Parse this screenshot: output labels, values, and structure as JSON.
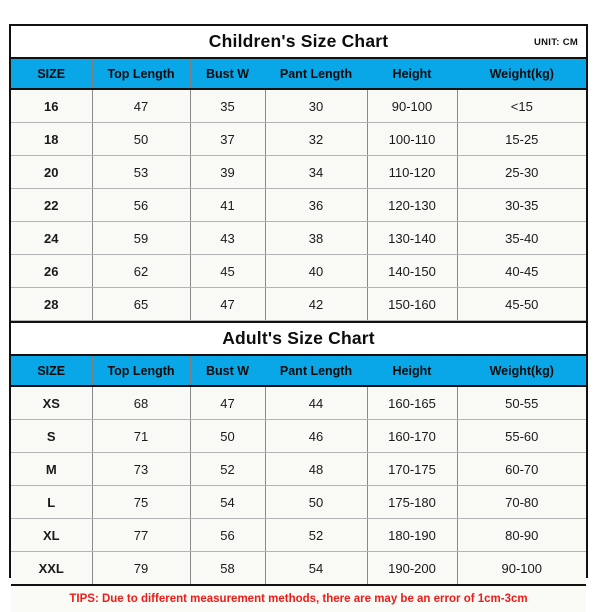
{
  "document": {
    "unit_label": "UNIT: CM",
    "columns": [
      "SIZE",
      "Top Length",
      "Bust W",
      "Pant Length",
      "Height",
      "Weight(kg)"
    ],
    "accent_header_color": "#0aa7e8",
    "tips_color": "#ef1b16",
    "border_color": "#111111"
  },
  "children_chart": {
    "title": "Children's Size Chart",
    "headers": [
      "SIZE",
      "Top Length",
      "Bust W",
      "Pant Length",
      "Height",
      "Weight(kg)"
    ],
    "rows": [
      {
        "size": "16",
        "top_length": "47",
        "bust_w": "35",
        "pant_length": "30",
        "height": "90-100",
        "weight": "<15"
      },
      {
        "size": "18",
        "top_length": "50",
        "bust_w": "37",
        "pant_length": "32",
        "height": "100-110",
        "weight": "15-25"
      },
      {
        "size": "20",
        "top_length": "53",
        "bust_w": "39",
        "pant_length": "34",
        "height": "110-120",
        "weight": "25-30"
      },
      {
        "size": "22",
        "top_length": "56",
        "bust_w": "41",
        "pant_length": "36",
        "height": "120-130",
        "weight": "30-35"
      },
      {
        "size": "24",
        "top_length": "59",
        "bust_w": "43",
        "pant_length": "38",
        "height": "130-140",
        "weight": "35-40"
      },
      {
        "size": "26",
        "top_length": "62",
        "bust_w": "45",
        "pant_length": "40",
        "height": "140-150",
        "weight": "40-45"
      },
      {
        "size": "28",
        "top_length": "65",
        "bust_w": "47",
        "pant_length": "42",
        "height": "150-160",
        "weight": "45-50"
      }
    ]
  },
  "adult_chart": {
    "title": "Adult's Size Chart",
    "headers": [
      "SIZE",
      "Top Length",
      "Bust W",
      "Pant Length",
      "Height",
      "Weight(kg)"
    ],
    "rows": [
      {
        "size": "XS",
        "top_length": "68",
        "bust_w": "47",
        "pant_length": "44",
        "height": "160-165",
        "weight": "50-55"
      },
      {
        "size": "S",
        "top_length": "71",
        "bust_w": "50",
        "pant_length": "46",
        "height": "160-170",
        "weight": "55-60"
      },
      {
        "size": "M",
        "top_length": "73",
        "bust_w": "52",
        "pant_length": "48",
        "height": "170-175",
        "weight": "60-70"
      },
      {
        "size": "L",
        "top_length": "75",
        "bust_w": "54",
        "pant_length": "50",
        "height": "175-180",
        "weight": "70-80"
      },
      {
        "size": "XL",
        "top_length": "77",
        "bust_w": "56",
        "pant_length": "52",
        "height": "180-190",
        "weight": "80-90"
      },
      {
        "size": "XXL",
        "top_length": "79",
        "bust_w": "58",
        "pant_length": "54",
        "height": "190-200",
        "weight": "90-100"
      }
    ]
  },
  "footer": {
    "tips": "TIPS: Due to different measurement methods, there are may be an error of 1cm-3cm"
  }
}
